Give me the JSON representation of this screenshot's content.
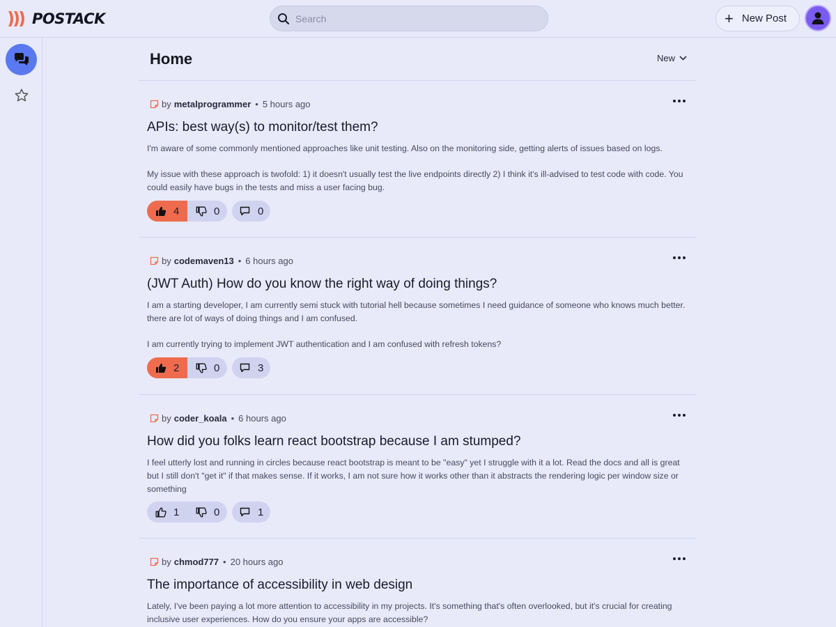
{
  "brand": {
    "name": "POSTACK"
  },
  "search": {
    "placeholder": "Search"
  },
  "header": {
    "new_post_label": "New Post"
  },
  "page": {
    "title": "Home",
    "sort_label": "New"
  },
  "colors": {
    "accent": "#ee6c4d",
    "primary": "#5a78f0",
    "avatar": "#7b5cf0",
    "background": "#e8eafa"
  },
  "posts": [
    {
      "by": "by",
      "author": "metalprogrammer",
      "time": "5 hours ago",
      "title": "APIs: best way(s) to monitor/test them?",
      "paragraphs": [
        "I'm aware of some commonly mentioned approaches like unit testing. Also on the monitoring side, getting alerts of issues based on logs.",
        "My issue with these approach is twofold: 1) it doesn't usually test the live endpoints directly 2) I think it's ill-advised to test code with code. You could easily have bugs in the tests and miss a user facing bug."
      ],
      "upvotes": "4",
      "downvotes": "0",
      "comments": "0",
      "upvoted": true
    },
    {
      "by": "by",
      "author": "codemaven13",
      "time": "6 hours ago",
      "title": "(JWT Auth) How do you know the right way of doing things?",
      "paragraphs": [
        "I am a starting developer, I am currently semi stuck with tutorial hell because sometimes I need guidance of someone who knows much better. there are lot of ways of doing things and I am confused.",
        "I am currently trying to implement JWT authentication and I am confused with refresh tokens?"
      ],
      "upvotes": "2",
      "downvotes": "0",
      "comments": "3",
      "upvoted": true
    },
    {
      "by": "by",
      "author": "coder_koala",
      "time": "6 hours ago",
      "title": "How did you folks learn react bootstrap because I am stumped?",
      "paragraphs": [
        "I feel utterly lost and running in circles because react bootstrap is meant to be \"easy\" yet I struggle with it a lot. Read the docs and all is great but I still don't \"get it\" if that makes sense. If it works, I am not sure how it works other than it abstracts the rendering logic per window size or something"
      ],
      "upvotes": "1",
      "downvotes": "0",
      "comments": "1",
      "upvoted": false
    },
    {
      "by": "by",
      "author": "chmod777",
      "time": "20 hours ago",
      "title": "The importance of accessibility in web design",
      "paragraphs": [
        "Lately, I've been paying a lot more attention to accessibility in my projects. It's something that's often overlooked, but it's crucial for creating inclusive user experiences. How do you ensure your apps are accessible?"
      ],
      "upvotes": "",
      "downvotes": "",
      "comments": "",
      "upvoted": false
    }
  ]
}
